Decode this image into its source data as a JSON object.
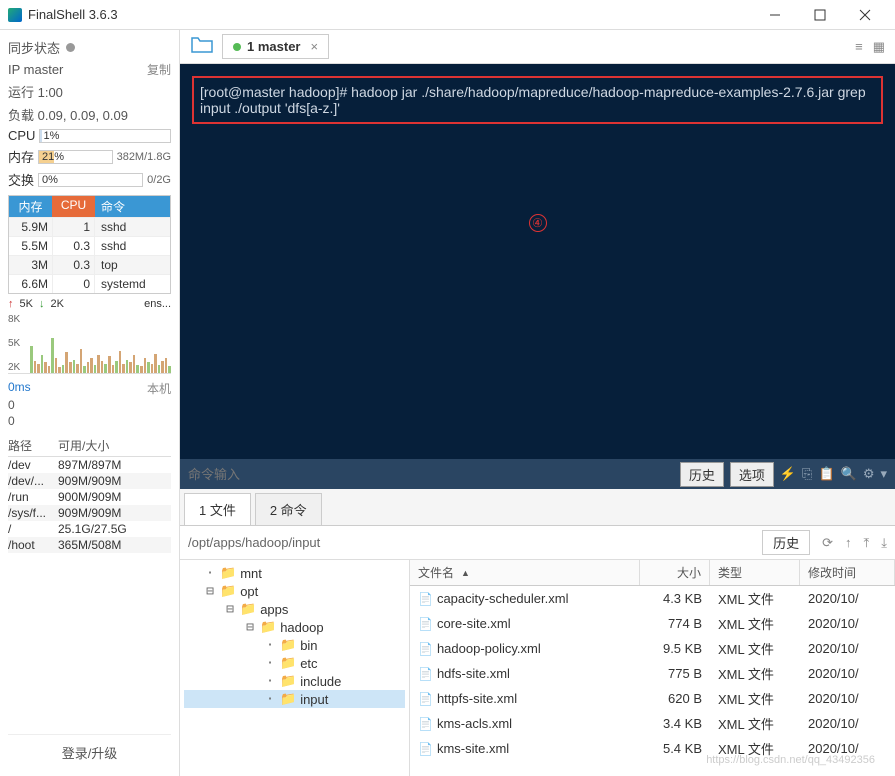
{
  "window": {
    "title": "FinalShell 3.6.3"
  },
  "sidebar": {
    "sync_label": "同步状态",
    "ip_label": "IP master",
    "copy": "复制",
    "run_label": "运行 1:00",
    "load_label": "负载 0.09, 0.09, 0.09",
    "cpu_label": "CPU",
    "cpu_pct": "1%",
    "mem_label": "内存",
    "mem_pct": "21%",
    "mem_val": "382M/1.8G",
    "swap_label": "交换",
    "swap_pct": "0%",
    "swap_val": "0/2G",
    "proc_headers": [
      "内存",
      "CPU",
      "命令"
    ],
    "procs": [
      {
        "mem": "5.9M",
        "cpu": "1",
        "cmd": "sshd"
      },
      {
        "mem": "5.5M",
        "cpu": "0.3",
        "cmd": "sshd"
      },
      {
        "mem": "3M",
        "cpu": "0.3",
        "cmd": "top"
      },
      {
        "mem": "6.6M",
        "cpu": "0",
        "cmd": "systemd"
      }
    ],
    "net_up": "5K",
    "net_down": "2K",
    "net_if": "ens...",
    "yticks": [
      "8K",
      "5K",
      "2K"
    ],
    "ping": "0ms",
    "local": "本机",
    "zeros": [
      "0",
      "0"
    ],
    "path_hdr": [
      "路径",
      "可用/大小"
    ],
    "paths": [
      {
        "p": "/dev",
        "s": "897M/897M"
      },
      {
        "p": "/dev/...",
        "s": "909M/909M"
      },
      {
        "p": "/run",
        "s": "900M/909M"
      },
      {
        "p": "/sys/f...",
        "s": "909M/909M"
      },
      {
        "p": "/",
        "s": "25.1G/27.5G"
      },
      {
        "p": "/hoot",
        "s": "365M/508M"
      }
    ],
    "login": "登录/升级"
  },
  "tabs": {
    "master": "1 master"
  },
  "terminal": {
    "line": "[root@master hadoop]# hadoop jar ./share/hadoop/mapreduce/hadoop-mapreduce-examples-2.7.6.jar grep input ./output 'dfs[a-z.]'",
    "marker": "④",
    "input_placeholder": "命令输入",
    "history": "历史",
    "options": "选项"
  },
  "filepanel": {
    "tab1": "1 文件",
    "tab2": "2 命令",
    "path": "/opt/apps/hadoop/input",
    "history": "历史",
    "tree": [
      {
        "lvl": 1,
        "exp": "",
        "name": "mnt"
      },
      {
        "lvl": 1,
        "exp": "⊟",
        "name": "opt"
      },
      {
        "lvl": 2,
        "exp": "⊟",
        "name": "apps"
      },
      {
        "lvl": 3,
        "exp": "⊟",
        "name": "hadoop"
      },
      {
        "lvl": 4,
        "exp": "",
        "name": "bin"
      },
      {
        "lvl": 4,
        "exp": "",
        "name": "etc"
      },
      {
        "lvl": 4,
        "exp": "",
        "name": "include"
      },
      {
        "lvl": 4,
        "exp": "",
        "name": "input",
        "sel": true
      }
    ],
    "cols": {
      "name": "文件名",
      "size": "大小",
      "type": "类型",
      "time": "修改时间"
    },
    "files": [
      {
        "n": "capacity-scheduler.xml",
        "s": "4.3 KB",
        "t": "XML 文件",
        "m": "2020/10/"
      },
      {
        "n": "core-site.xml",
        "s": "774 B",
        "t": "XML 文件",
        "m": "2020/10/"
      },
      {
        "n": "hadoop-policy.xml",
        "s": "9.5 KB",
        "t": "XML 文件",
        "m": "2020/10/"
      },
      {
        "n": "hdfs-site.xml",
        "s": "775 B",
        "t": "XML 文件",
        "m": "2020/10/"
      },
      {
        "n": "httpfs-site.xml",
        "s": "620 B",
        "t": "XML 文件",
        "m": "2020/10/"
      },
      {
        "n": "kms-acls.xml",
        "s": "3.4 KB",
        "t": "XML 文件",
        "m": "2020/10/"
      },
      {
        "n": "kms-site.xml",
        "s": "5.4 KB",
        "t": "XML 文件",
        "m": "2020/10/"
      }
    ]
  },
  "watermark": "https://blog.csdn.net/qq_43492356"
}
